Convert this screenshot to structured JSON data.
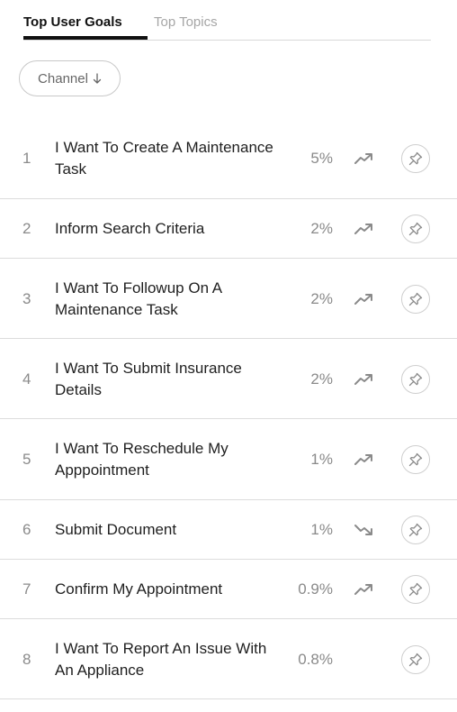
{
  "tabs": {
    "active": "Top User Goals",
    "inactive": "Top Topics"
  },
  "filter": {
    "channel_label": "Channel"
  },
  "goals": [
    {
      "rank": "1",
      "label": "I Want To Create A Maintenance Task",
      "percent": "5%",
      "trend": "up"
    },
    {
      "rank": "2",
      "label": "Inform Search Criteria",
      "percent": "2%",
      "trend": "up"
    },
    {
      "rank": "3",
      "label": "I Want To Followup On A Maintenance Task",
      "percent": "2%",
      "trend": "up"
    },
    {
      "rank": "4",
      "label": "I Want To Submit Insurance Details",
      "percent": "2%",
      "trend": "up"
    },
    {
      "rank": "5",
      "label": "I Want To Reschedule My Apppointment",
      "percent": "1%",
      "trend": "up"
    },
    {
      "rank": "6",
      "label": "Submit Document",
      "percent": "1%",
      "trend": "down"
    },
    {
      "rank": "7",
      "label": "Confirm My Appointment",
      "percent": "0.9%",
      "trend": "up"
    },
    {
      "rank": "8",
      "label": "I Want To Report An Issue With An Appliance",
      "percent": "0.8%",
      "trend": "none"
    }
  ],
  "colors": {
    "text": "#1f1f1f",
    "muted": "#8a8a8a",
    "divider": "#dcdcdc",
    "icon": "#8a8a8a"
  }
}
